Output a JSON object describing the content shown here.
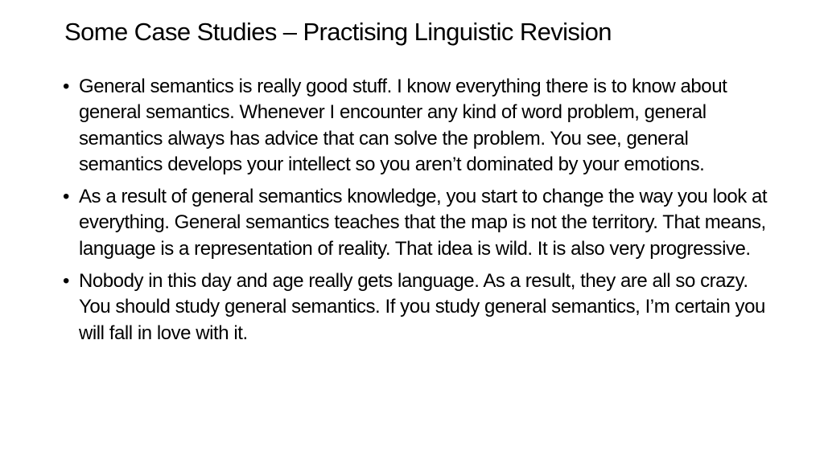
{
  "slide": {
    "title": "Some Case Studies – Practising Linguistic Revision",
    "bullet_glyph": "•",
    "bullets": [
      "General semantics is really good stuff. I know everything there is to know about general semantics. Whenever I encounter any kind of word problem, general semantics always has advice that can solve the problem. You see, general semantics develops your intellect so you aren’t dominated by your emotions.",
      "As a result of general semantics knowledge, you start to change the way you look at everything. General semantics teaches that the map is not the territory. That means, language is a representation of reality. That idea is wild. It is also very progressive.",
      "Nobody in this day and age really gets language. As a result, they are all so crazy. You should study general semantics. If you study general semantics, I’m certain you will fall in love with it."
    ]
  }
}
